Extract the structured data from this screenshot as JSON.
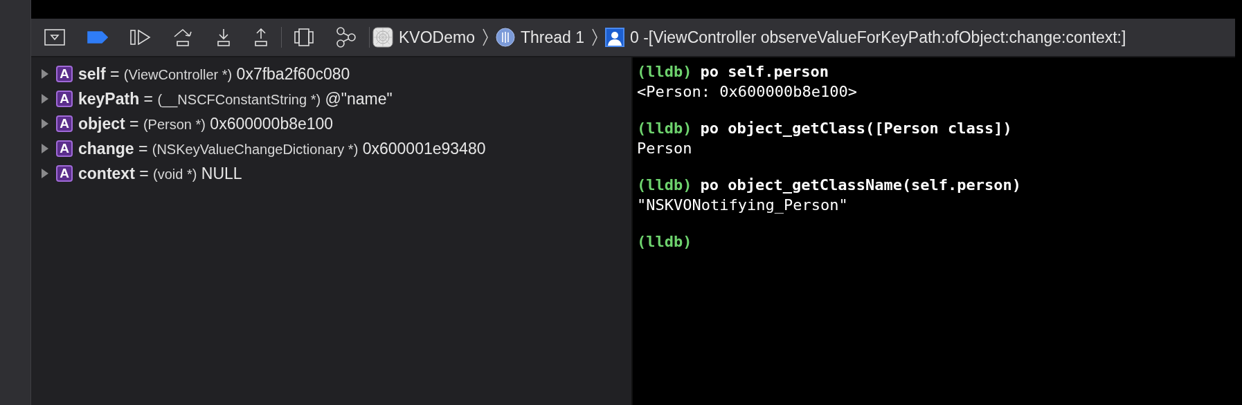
{
  "toolbar": {
    "breakpoints_active": true
  },
  "breadcrumb": [
    {
      "kind": "app",
      "label": "KVODemo"
    },
    {
      "kind": "thread",
      "label": "Thread 1"
    },
    {
      "kind": "frame",
      "label": "0 -[ViewController observeValueForKeyPath:ofObject:change:context:]"
    }
  ],
  "variables": [
    {
      "badge": "A",
      "name": "self",
      "equals": "=",
      "type": "(ViewController *)",
      "value": "0x7fba2f60c080",
      "expanded": false
    },
    {
      "badge": "A",
      "name": "keyPath",
      "equals": "=",
      "type": "(__NSCFConstantString *)",
      "value": "@\"name\"",
      "expanded": false
    },
    {
      "badge": "A",
      "name": "object",
      "equals": "=",
      "type": "(Person *)",
      "value": "0x600000b8e100",
      "expanded": false
    },
    {
      "badge": "A",
      "name": "change",
      "equals": "=",
      "type": "(NSKeyValueChangeDictionary *)",
      "value": "0x600001e93480",
      "expanded": false
    },
    {
      "badge": "A",
      "name": "context",
      "equals": "=",
      "type": "(void *)",
      "value": "NULL",
      "expanded": false
    }
  ],
  "console": [
    {
      "prompt": "(lldb)",
      "command": "po self.person",
      "output": "<Person: 0x600000b8e100>"
    },
    {
      "prompt": "(lldb)",
      "command": "po object_getClass([Person class])",
      "output": "Person"
    },
    {
      "prompt": "(lldb)",
      "command": "po object_getClassName(self.person)",
      "output": "\"NSKVONotifying_Person\""
    },
    {
      "prompt": "(lldb)"
    }
  ]
}
